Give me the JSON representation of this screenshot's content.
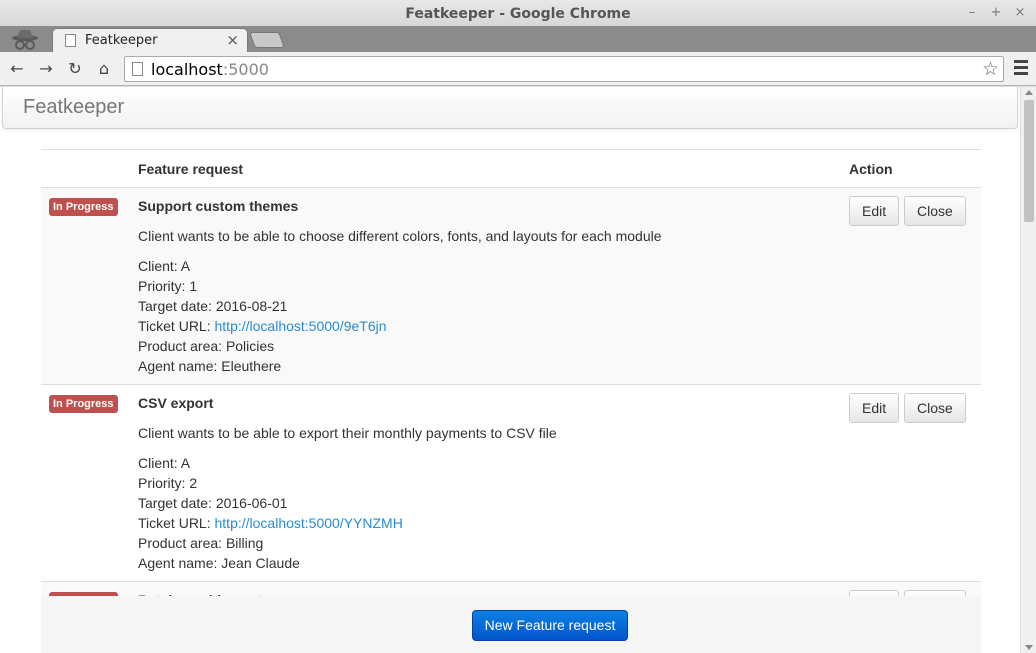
{
  "window": {
    "title": "Featkeeper - Google Chrome",
    "minimize": "–",
    "maximize": "+",
    "close": "×"
  },
  "tab": {
    "label": "Featkeeper",
    "close": "×"
  },
  "omnibox": {
    "host": "localhost",
    "port": ":5000"
  },
  "app": {
    "brand": "Featkeeper"
  },
  "table": {
    "headers": {
      "feature": "Feature request",
      "action": "Action"
    },
    "rows": [
      {
        "status": "In Progress",
        "title": "Support custom themes",
        "description": "Client wants to be able to choose different colors, fonts, and layouts for each module",
        "client": "Client: A",
        "priority": "Priority: 1",
        "target": "Target date: 2016-08-21",
        "ticket_prefix": "Ticket URL: ",
        "ticket_url": "http://localhost:5000/9eT6jn",
        "area": "Product area: Policies",
        "agent": "Agent name: Eleuthere",
        "edit": "Edit",
        "close": "Close"
      },
      {
        "status": "In Progress",
        "title": "CSV export",
        "description": "Client wants to be able to export their monthly payments to CSV file",
        "client": "Client: A",
        "priority": "Priority: 2",
        "target": "Target date: 2016-06-01",
        "ticket_prefix": "Ticket URL: ",
        "ticket_url": "http://localhost:5000/YYNZMH",
        "area": "Product area: Billing",
        "agent": "Agent name: Jean Claude",
        "edit": "Edit",
        "close": "Close"
      },
      {
        "status": "In Progress",
        "title": "Batch machine setup",
        "edit": "Edit",
        "close": "Close"
      }
    ]
  },
  "footer": {
    "new_request": "New Feature request"
  },
  "colors": {
    "status_label": "#c0504d",
    "primary": "#0066d6",
    "link": "#2a8bd0"
  }
}
